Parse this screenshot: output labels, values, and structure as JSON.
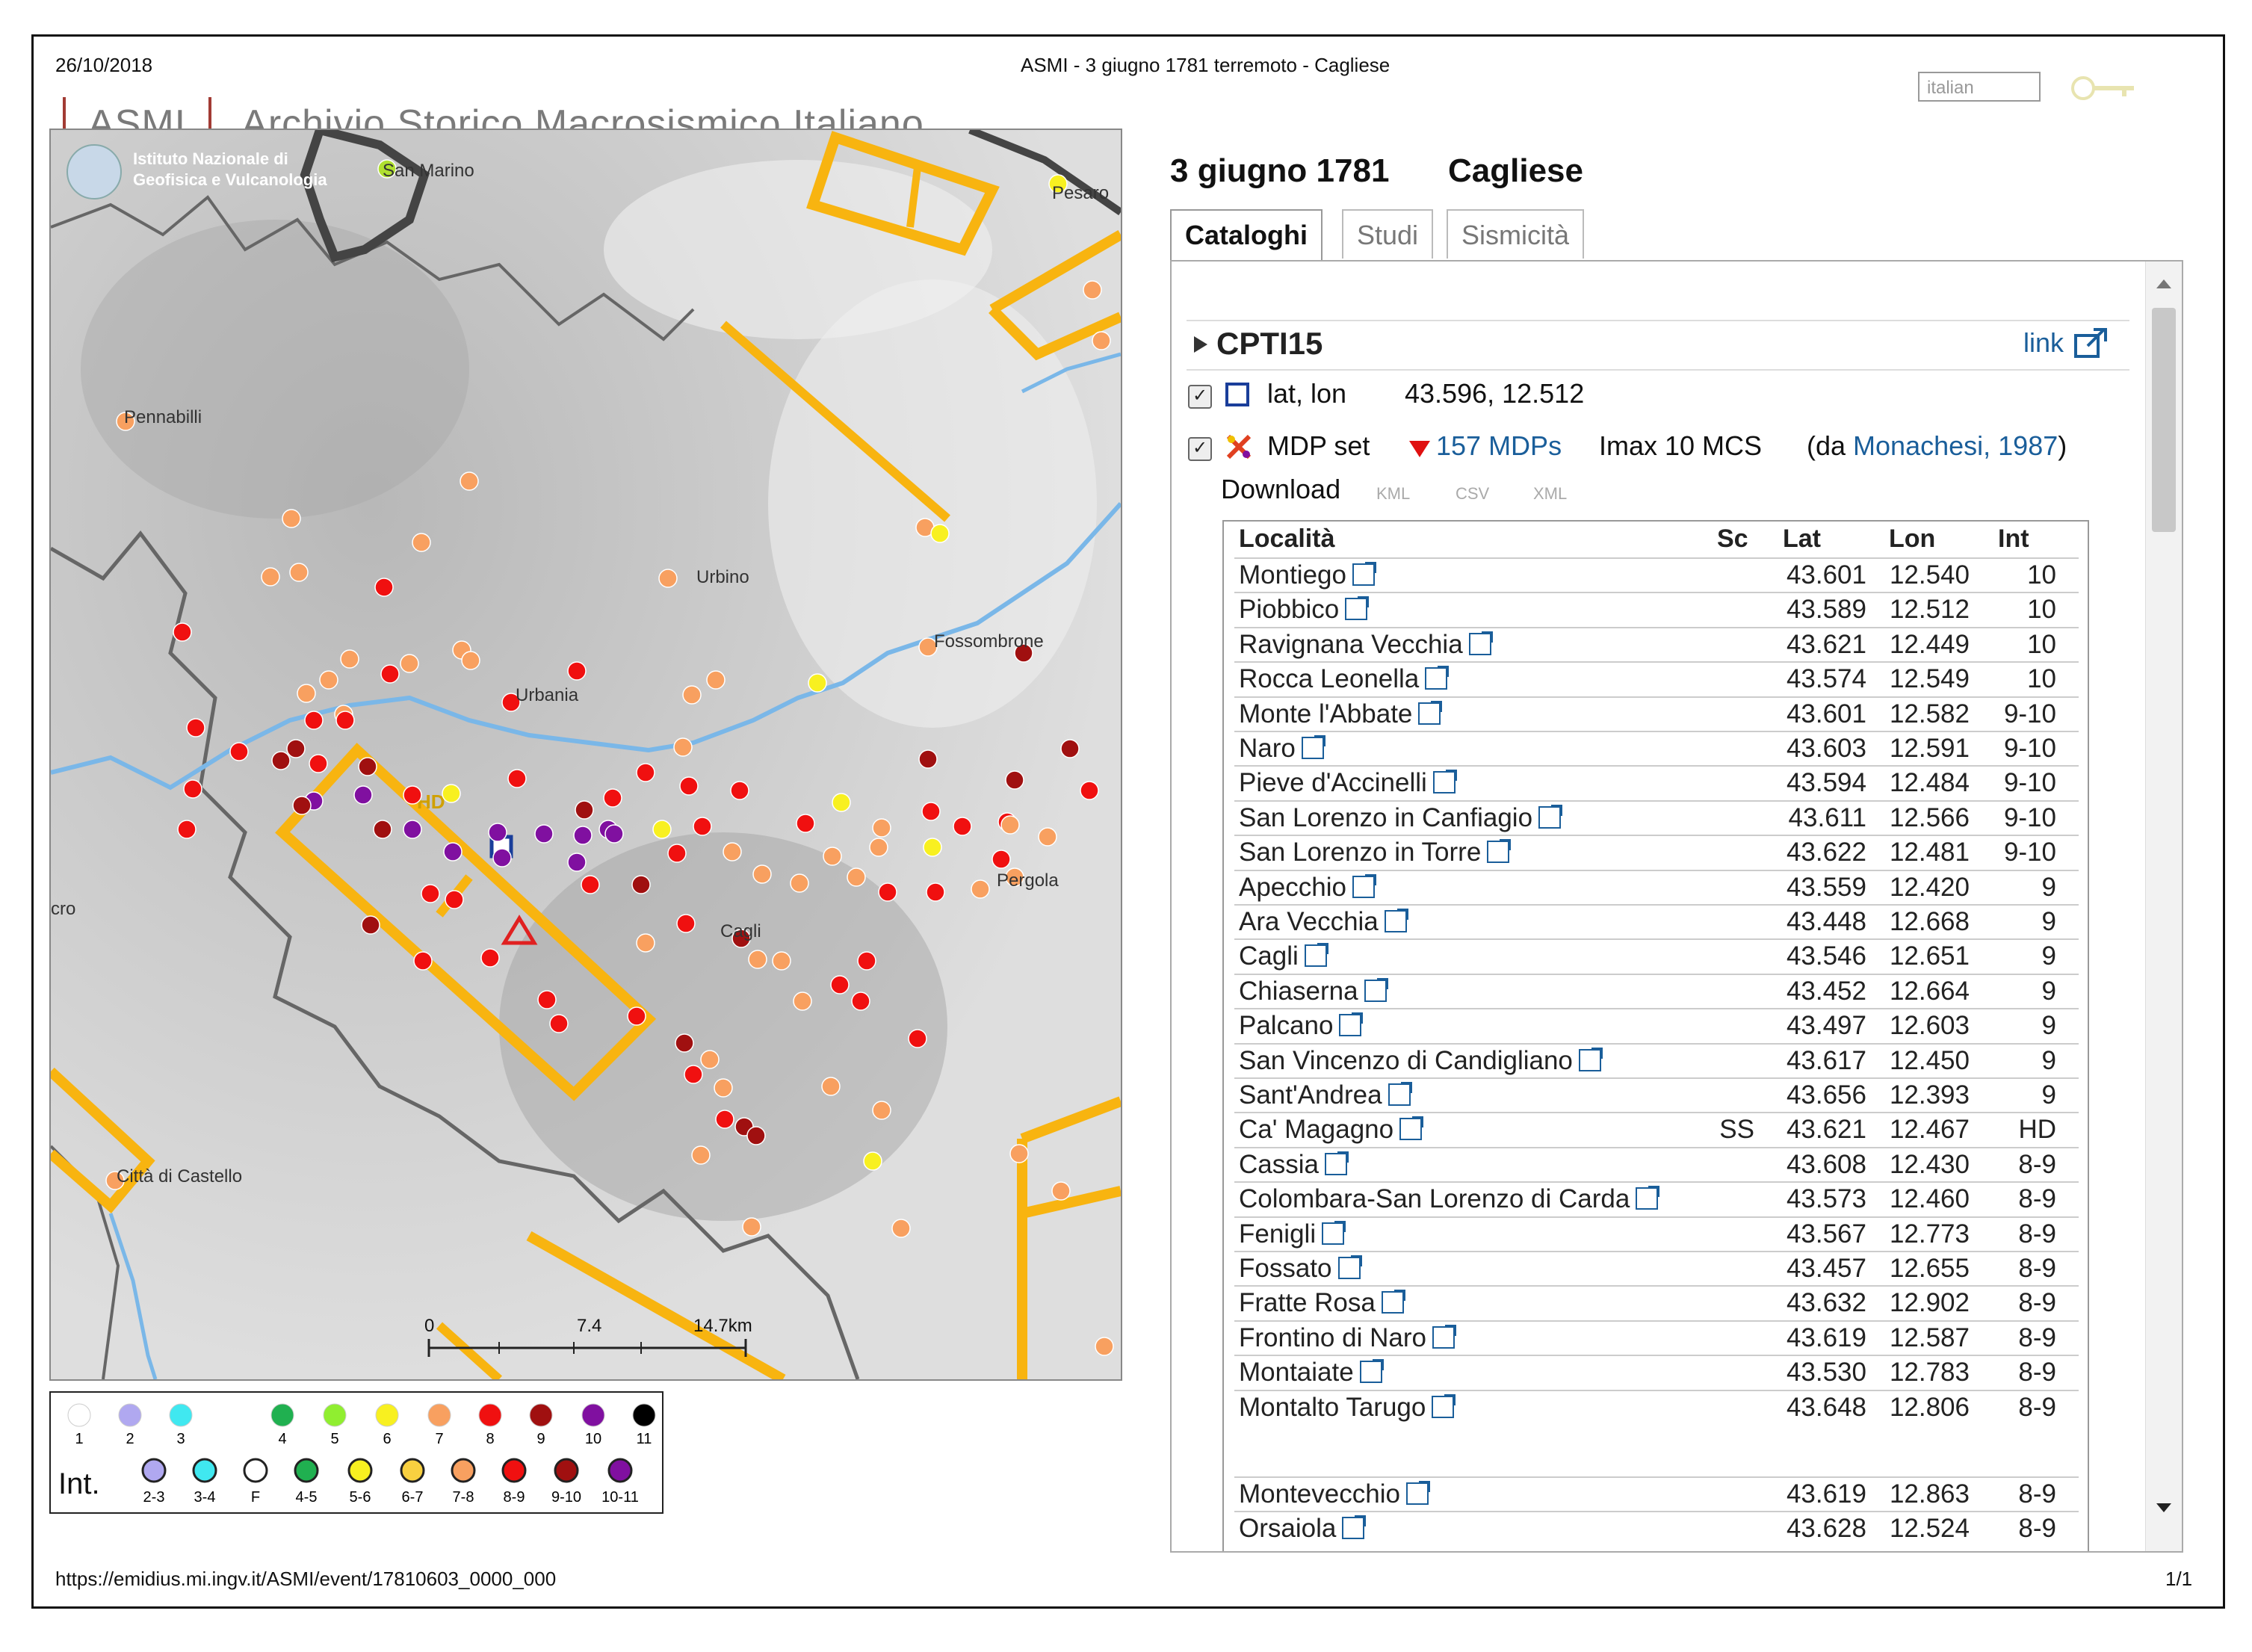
{
  "print_header": {
    "date": "26/10/2018",
    "title": "ASMI - 3 giugno 1781 terremoto - Cagliese"
  },
  "brand": {
    "short": "ASMI",
    "full": "Archivio Storico Macrosismico Italiano"
  },
  "language_input": {
    "value": "italian"
  },
  "event": {
    "date": "3 giugno 1781",
    "name": "Cagliese"
  },
  "tabs": [
    {
      "label": "Cataloghi"
    },
    {
      "label": "Studi"
    },
    {
      "label": "Sismicità"
    }
  ],
  "catalog": {
    "name": "CPTI15",
    "link_label": "link",
    "latlon_label": "lat, lon",
    "latlon_value": "43.596, 12.512",
    "mdp_label": "MDP set",
    "mdp_count": "157 MDPs",
    "imax": "Imax 10 MCS",
    "source_prefix": "(da ",
    "source_link": "Monachesi, 1987",
    "source_suffix": ")",
    "download_label": "Download",
    "formats": [
      "KML",
      "CSV",
      "XML"
    ]
  },
  "table": {
    "headers": {
      "localita": "Località",
      "sc": "Sc",
      "lat": "Lat",
      "lon": "Lon",
      "int": "Int"
    },
    "rows": [
      {
        "name": "Montiego",
        "sc": "",
        "lat": "43.601",
        "lon": "12.540",
        "int": "10"
      },
      {
        "name": "Piobbico",
        "sc": "",
        "lat": "43.589",
        "lon": "12.512",
        "int": "10"
      },
      {
        "name": "Ravignana Vecchia",
        "sc": "",
        "lat": "43.621",
        "lon": "12.449",
        "int": "10"
      },
      {
        "name": "Rocca Leonella",
        "sc": "",
        "lat": "43.574",
        "lon": "12.549",
        "int": "10"
      },
      {
        "name": "Monte l'Abbate",
        "sc": "",
        "lat": "43.601",
        "lon": "12.582",
        "int": "9-10"
      },
      {
        "name": "Naro",
        "sc": "",
        "lat": "43.603",
        "lon": "12.591",
        "int": "9-10"
      },
      {
        "name": "Pieve d'Accinelli",
        "sc": "",
        "lat": "43.594",
        "lon": "12.484",
        "int": "9-10"
      },
      {
        "name": "San Lorenzo in Canfiagio",
        "sc": "",
        "lat": "43.611",
        "lon": "12.566",
        "int": "9-10"
      },
      {
        "name": "San Lorenzo in Torre",
        "sc": "",
        "lat": "43.622",
        "lon": "12.481",
        "int": "9-10"
      },
      {
        "name": "Apecchio",
        "sc": "",
        "lat": "43.559",
        "lon": "12.420",
        "int": "9"
      },
      {
        "name": "Ara Vecchia",
        "sc": "",
        "lat": "43.448",
        "lon": "12.668",
        "int": "9"
      },
      {
        "name": "Cagli",
        "sc": "",
        "lat": "43.546",
        "lon": "12.651",
        "int": "9"
      },
      {
        "name": "Chiaserna",
        "sc": "",
        "lat": "43.452",
        "lon": "12.664",
        "int": "9"
      },
      {
        "name": "Palcano",
        "sc": "",
        "lat": "43.497",
        "lon": "12.603",
        "int": "9"
      },
      {
        "name": "San Vincenzo di Candigliano",
        "sc": "",
        "lat": "43.617",
        "lon": "12.450",
        "int": "9"
      },
      {
        "name": "Sant'Andrea",
        "sc": "",
        "lat": "43.656",
        "lon": "12.393",
        "int": "9"
      },
      {
        "name": "Ca' Magagno",
        "sc": "SS",
        "lat": "43.621",
        "lon": "12.467",
        "int": "HD"
      },
      {
        "name": "Cassia",
        "sc": "",
        "lat": "43.608",
        "lon": "12.430",
        "int": "8-9"
      },
      {
        "name": "Colombara-San Lorenzo di Carda",
        "sc": "",
        "lat": "43.573",
        "lon": "12.460",
        "int": "8-9"
      },
      {
        "name": "Fenigli",
        "sc": "",
        "lat": "43.567",
        "lon": "12.773",
        "int": "8-9"
      },
      {
        "name": "Fossato",
        "sc": "",
        "lat": "43.457",
        "lon": "12.655",
        "int": "8-9"
      },
      {
        "name": "Fratte Rosa",
        "sc": "",
        "lat": "43.632",
        "lon": "12.902",
        "int": "8-9"
      },
      {
        "name": "Frontino di Naro",
        "sc": "",
        "lat": "43.619",
        "lon": "12.587",
        "int": "8-9"
      },
      {
        "name": "Montaiate",
        "sc": "",
        "lat": "43.530",
        "lon": "12.783",
        "int": "8-9"
      },
      {
        "name": "Montalto Tarugo",
        "sc": "",
        "lat": "43.648",
        "lon": "12.806",
        "int": "8-9"
      },
      {
        "name": "Montevecchio",
        "sc": "",
        "lat": "43.619",
        "lon": "12.863",
        "int": "8-9"
      },
      {
        "name": "Orsaiola",
        "sc": "",
        "lat": "43.628",
        "lon": "12.524",
        "int": "8-9"
      }
    ]
  },
  "map": {
    "attribution": "Istituto Nazionale di Geofisica e Vulcanologia",
    "places": [
      "San Marino",
      "Pesaro",
      "Pennabilli",
      "Urbino",
      "Fossombrone",
      "Urbania",
      "Pergola",
      "Cagli",
      "Città di Castello",
      "cro"
    ],
    "scale": {
      "start": "0",
      "mid": "7.4",
      "end": "14.7km"
    }
  },
  "legend": {
    "int_label": "Int.",
    "top": [
      {
        "label": "1",
        "color": "#ffffff"
      },
      {
        "label": "2",
        "color": "#b0a8f0"
      },
      {
        "label": "3",
        "color": "#40e8f0"
      },
      {
        "label": "4",
        "color": "#20b050"
      },
      {
        "label": "5",
        "color": "#90ee30"
      },
      {
        "label": "6",
        "color": "#f8f020"
      },
      {
        "label": "7",
        "color": "#f8a060"
      },
      {
        "label": "8",
        "color": "#f01010"
      },
      {
        "label": "9",
        "color": "#a01010"
      },
      {
        "label": "10",
        "color": "#8010a0"
      },
      {
        "label": "11",
        "color": "#000000"
      }
    ],
    "bottom": [
      {
        "label": "2-3",
        "color": "#b0a8f0"
      },
      {
        "label": "3-4",
        "color": "#40e8f0"
      },
      {
        "label": "F",
        "color": "#ffffff"
      },
      {
        "label": "4-5",
        "color": "#20b050"
      },
      {
        "label": "5-6",
        "color": "#f8f020"
      },
      {
        "label": "6-7",
        "color": "#f8d040"
      },
      {
        "label": "7-8",
        "color": "#f8a060"
      },
      {
        "label": "8-9",
        "color": "#f01010"
      },
      {
        "label": "9-10",
        "color": "#a01010"
      },
      {
        "label": "10-11",
        "color": "#8010a0"
      }
    ]
  },
  "footer": {
    "url": "https://emidius.mi.ingv.it/ASMI/event/17810603_0000_000",
    "page": "1/1"
  }
}
